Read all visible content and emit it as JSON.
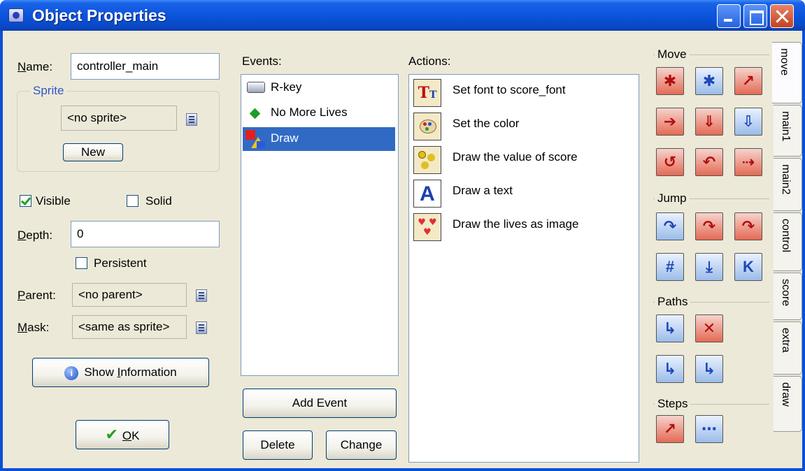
{
  "window": {
    "title": "Object Properties"
  },
  "left": {
    "name_label": "Name:",
    "name_value": "controller_main",
    "sprite_group_label": "Sprite",
    "sprite_value": "<no sprite>",
    "new_button": "New",
    "visible_label": "Visible",
    "visible_checked": true,
    "solid_label": "Solid",
    "solid_checked": false,
    "depth_label": "Depth:",
    "depth_value": "0",
    "persistent_label": "Persistent",
    "persistent_checked": false,
    "parent_label": "Parent:",
    "parent_value": "<no parent>",
    "mask_label": "Mask:",
    "mask_value": "<same as sprite>",
    "show_info_button": "Show Information",
    "ok_button": "OK"
  },
  "events": {
    "label": "Events:",
    "items": [
      {
        "label": "R-key",
        "icon": "keyboard-icon"
      },
      {
        "label": "No More Lives",
        "icon": "green-diamond-icon"
      },
      {
        "label": "Draw",
        "icon": "draw-shapes-icon",
        "selected": true
      }
    ],
    "add_button": "Add Event",
    "delete_button": "Delete",
    "change_button": "Change"
  },
  "actions": {
    "label": "Actions:",
    "items": [
      {
        "label": "Set font to score_font",
        "icon": "font-icon"
      },
      {
        "label": "Set the color",
        "icon": "palette-icon"
      },
      {
        "label": "Draw the value of score",
        "icon": "coins-icon"
      },
      {
        "label": "Draw a text",
        "icon": "letter-a-icon"
      },
      {
        "label": "Draw the lives as image",
        "icon": "hearts-icon"
      }
    ]
  },
  "palette": {
    "groups": [
      {
        "label": "Move"
      },
      {
        "label": "Jump"
      },
      {
        "label": "Paths"
      },
      {
        "label": "Steps"
      }
    ]
  },
  "tabs": [
    "move",
    "main1",
    "main2",
    "control",
    "score",
    "extra",
    "draw"
  ]
}
